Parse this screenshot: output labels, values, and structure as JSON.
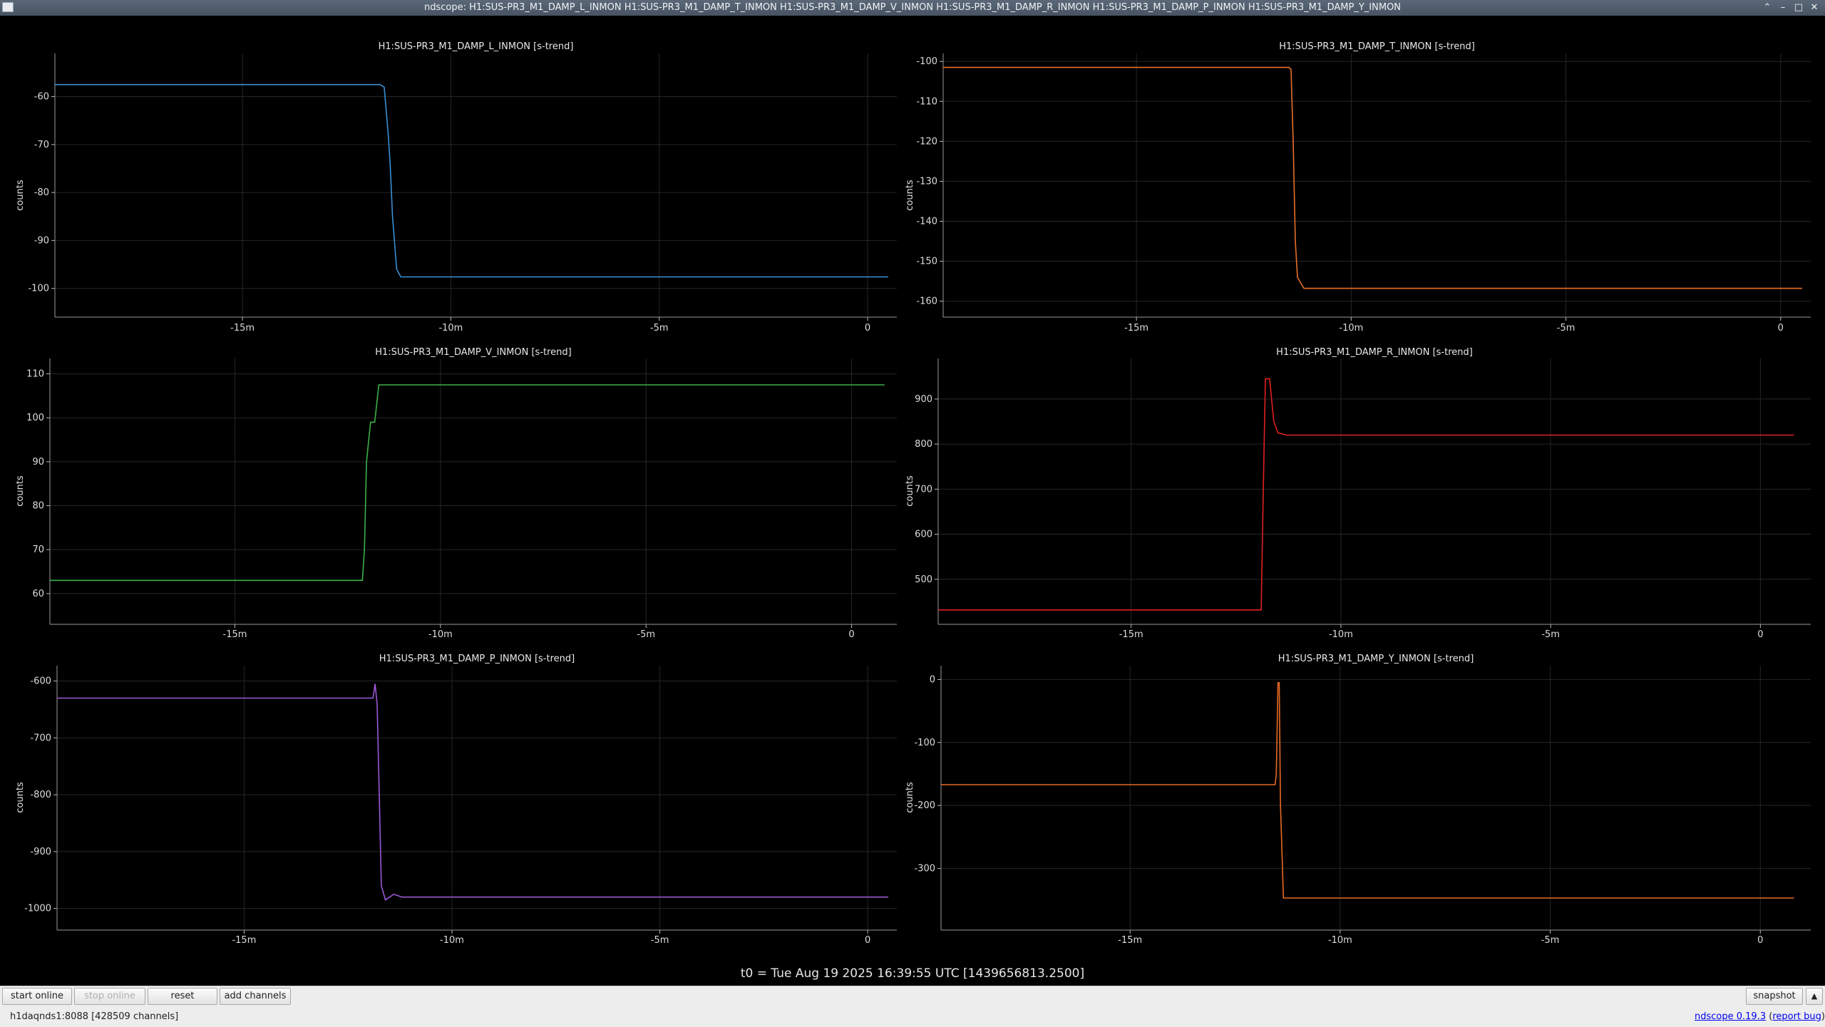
{
  "window": {
    "title": "ndscope: H1:SUS-PR3_M1_DAMP_L_INMON H1:SUS-PR3_M1_DAMP_T_INMON H1:SUS-PR3_M1_DAMP_V_INMON H1:SUS-PR3_M1_DAMP_R_INMON H1:SUS-PR3_M1_DAMP_P_INMON H1:SUS-PR3_M1_DAMP_Y_INMON",
    "buttons": {
      "shade": "⌃",
      "minimize": "–",
      "maximize": "□",
      "close": "✕"
    }
  },
  "t0_label": "t0 = Tue Aug 19 2025 16:39:55 UTC [1439656813.2500]",
  "toolbar": {
    "start_online": "start online",
    "stop_online": "stop online",
    "reset": "reset",
    "add_channels": "add channels",
    "snapshot": "snapshot",
    "expand": "▲"
  },
  "status": {
    "server": "h1daqnds1:8088  [428509 channels]"
  },
  "version": {
    "link": "ndscope 0.19.3",
    "report": "report bug"
  },
  "chart_data": [
    {
      "type": "line",
      "title": "H1:SUS-PR3_M1_DAMP_L_INMON [s-trend]",
      "ylabel": "counts",
      "color": "#3a8fd6",
      "xlim": [
        -19.5,
        0.7
      ],
      "ylim": [
        -106,
        -51
      ],
      "xticks": [
        -15,
        -10,
        -5,
        0
      ],
      "xtick_labels": [
        "-15m",
        "-10m",
        "-5m",
        "0"
      ],
      "yticks": [
        -60,
        -70,
        -80,
        -90,
        -100
      ],
      "series": [
        {
          "x": [
            -19.5,
            -11.7,
            -11.6,
            -11.5,
            -11.45,
            -11.4,
            -11.3,
            -11.2,
            0.8
          ],
          "y": [
            -57.5,
            -57.5,
            -58,
            -68,
            -75,
            -85,
            -96,
            -97.6,
            -97.6
          ]
        }
      ]
    },
    {
      "type": "line",
      "title": "H1:SUS-PR3_M1_DAMP_T_INMON [s-trend]",
      "ylabel": "counts",
      "color": "#e8702a",
      "xlim": [
        -19.5,
        0.7
      ],
      "ylim": [
        -164,
        -98
      ],
      "xticks": [
        -15,
        -10,
        -5,
        0
      ],
      "xtick_labels": [
        "-15m",
        "-10m",
        "-5m",
        "0"
      ],
      "yticks": [
        -100,
        -110,
        -120,
        -130,
        -140,
        -150,
        -160
      ],
      "series": [
        {
          "x": [
            -19.5,
            -11.45,
            -11.4,
            -11.35,
            -11.3,
            -11.25,
            -11.2,
            -11.1,
            0.8
          ],
          "y": [
            -101.5,
            -101.5,
            -102,
            -120,
            -145,
            -154,
            -155,
            -156.8,
            -156.8
          ]
        }
      ]
    },
    {
      "type": "line",
      "title": "H1:SUS-PR3_M1_DAMP_V_INMON [s-trend]",
      "ylabel": "counts",
      "color": "#3db14a",
      "xlim": [
        -19.5,
        1.1
      ],
      "ylim": [
        53,
        113.5
      ],
      "xticks": [
        -15,
        -10,
        -5,
        0
      ],
      "xtick_labels": [
        "-15m",
        "-10m",
        "-5m",
        "0"
      ],
      "yticks": [
        110,
        100,
        90,
        80,
        70,
        60
      ],
      "series": [
        {
          "x": [
            -19.5,
            -11.9,
            -11.85,
            -11.8,
            -11.7,
            -11.6,
            -11.5,
            0.8
          ],
          "y": [
            63,
            63,
            70,
            90,
            99,
            99,
            107.5,
            107.5
          ]
        }
      ]
    },
    {
      "type": "line",
      "title": "H1:SUS-PR3_M1_DAMP_R_INMON [s-trend]",
      "ylabel": "counts",
      "color": "#e02020",
      "xlim": [
        -19.6,
        1.2
      ],
      "ylim": [
        400,
        990
      ],
      "xticks": [
        -15,
        -10,
        -5,
        0
      ],
      "xtick_labels": [
        "-15m",
        "-10m",
        "-5m",
        "0"
      ],
      "yticks": [
        900,
        800,
        700,
        600,
        500
      ],
      "series": [
        {
          "x": [
            -19.6,
            -11.9,
            -11.85,
            -11.8,
            -11.7,
            -11.6,
            -11.5,
            -11.3,
            0.8
          ],
          "y": [
            432,
            432,
            700,
            945,
            945,
            850,
            825,
            820,
            820
          ]
        }
      ]
    },
    {
      "type": "line",
      "title": "H1:SUS-PR3_M1_DAMP_P_INMON [s-trend]",
      "ylabel": "counts",
      "color": "#9b59d6",
      "xlim": [
        -19.5,
        0.7
      ],
      "ylim": [
        -1038,
        -573
      ],
      "xticks": [
        -15,
        -10,
        -5,
        0
      ],
      "xtick_labels": [
        "-15m",
        "-10m",
        "-5m",
        "0"
      ],
      "yticks": [
        -600,
        -700,
        -800,
        -900,
        -1000
      ],
      "series": [
        {
          "x": [
            -19.5,
            -11.9,
            -11.85,
            -11.8,
            -11.75,
            -11.7,
            -11.6,
            -11.4,
            -11.2,
            0.8
          ],
          "y": [
            -630,
            -630,
            -605,
            -640,
            -800,
            -960,
            -985,
            -975,
            -980,
            -980
          ]
        }
      ]
    },
    {
      "type": "line",
      "title": "H1:SUS-PR3_M1_DAMP_Y_INMON [s-trend]",
      "ylabel": "counts",
      "color": "#e86a24",
      "xlim": [
        -19.5,
        1.2
      ],
      "ylim": [
        -398,
        22
      ],
      "xticks": [
        -15,
        -10,
        -5,
        0
      ],
      "xtick_labels": [
        "-15m",
        "-10m",
        "-5m",
        "0"
      ],
      "yticks": [
        0,
        -100,
        -200,
        -300
      ],
      "series": [
        {
          "x": [
            -19.5,
            -11.55,
            -11.52,
            -11.48,
            -11.45,
            -11.42,
            -11.35,
            0.8
          ],
          "y": [
            -167,
            -167,
            -150,
            -5,
            -5,
            -200,
            -347,
            -347
          ]
        }
      ]
    }
  ]
}
